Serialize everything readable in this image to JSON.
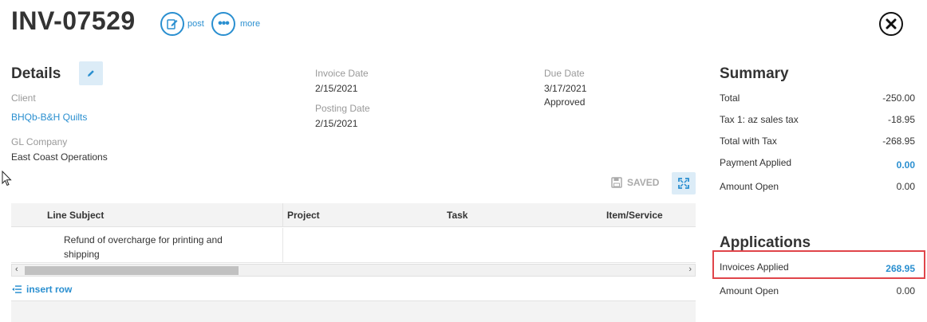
{
  "header": {
    "invoice_number": "INV-07529",
    "post_label": "post",
    "more_label": "more"
  },
  "details": {
    "heading": "Details",
    "client_label": "Client",
    "client_value": "BHQb-B&H Quilts",
    "gl_label": "GL Company",
    "gl_value": "East Coast Operations",
    "invoice_date_label": "Invoice Date",
    "invoice_date_value": "2/15/2021",
    "posting_date_label": "Posting Date",
    "posting_date_value": "2/15/2021",
    "due_date_label": "Due Date",
    "due_date_value": "3/17/2021",
    "status_value": "Approved"
  },
  "summary": {
    "heading": "Summary",
    "rows": [
      {
        "label": "Total",
        "value": "-250.00"
      },
      {
        "label": "Tax 1: az sales tax",
        "value": "-18.95"
      },
      {
        "label": "Total with Tax",
        "value": "-268.95"
      },
      {
        "label": "Payment Applied",
        "value": "0.00"
      },
      {
        "label": "Amount Open",
        "value": "0.00"
      }
    ]
  },
  "applications": {
    "heading": "Applications",
    "rows": [
      {
        "label": "Invoices Applied",
        "value": "268.95"
      },
      {
        "label": "Amount Open",
        "value": "0.00"
      }
    ]
  },
  "grid": {
    "saved_label": "SAVED",
    "columns": [
      "Line Subject",
      "Project",
      "Task",
      "Item/Service"
    ],
    "rows": [
      {
        "line_subject": "Refund of overcharge for printing and shipping"
      }
    ],
    "insert_row_label": "insert row"
  },
  "colors": {
    "accent": "#2a8fd0",
    "highlight": "#e0454a"
  }
}
